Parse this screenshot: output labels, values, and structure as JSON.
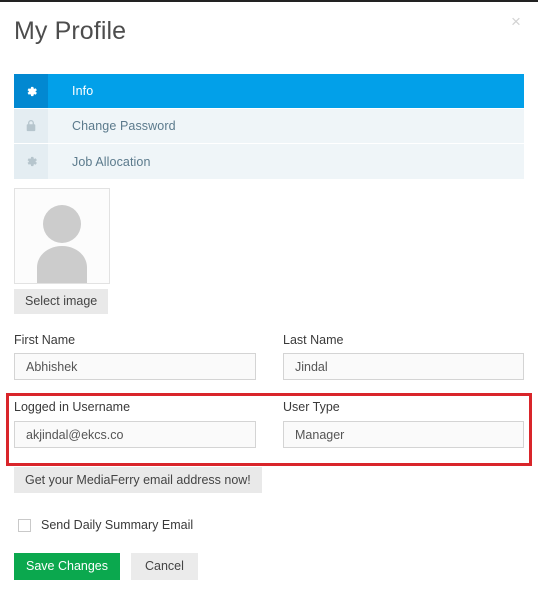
{
  "window": {
    "title": "My Profile",
    "close_label": "×"
  },
  "tabs": [
    {
      "label": "Info",
      "icon": "gear-icon",
      "active": true
    },
    {
      "label": "Change Password",
      "icon": "lock-icon",
      "active": false
    },
    {
      "label": "Job Allocation",
      "icon": "gear-icon",
      "active": false
    }
  ],
  "avatar": {
    "icon": "user-placeholder-icon",
    "select_image_label": "Select image"
  },
  "form": {
    "first_name": {
      "label": "First Name",
      "value": "Abhishek",
      "placeholder": "First Name"
    },
    "last_name": {
      "label": "Last Name",
      "value": "Jindal",
      "placeholder": "Last Name"
    },
    "logged_in_username": {
      "label": "Logged in Username",
      "value": "akjindal@ekcs.co",
      "placeholder": "Logged in Username"
    },
    "user_type": {
      "label": "User Type",
      "value": "Manager",
      "placeholder": "User Type"
    }
  },
  "mediaferry_button": {
    "label": "Get your MediaFerry email address now!"
  },
  "daily_summary": {
    "label": "Send Daily Summary Email",
    "checked": false
  },
  "footer": {
    "save_label": "Save Changes",
    "cancel_label": "Cancel"
  },
  "colors": {
    "accent_blue": "#02a0e9",
    "accent_blue_dark": "#0288d1",
    "tab_inactive": "#eff5f8",
    "save_green": "#0ba84e",
    "highlight_red": "#d9252a",
    "button_gray": "#e9e9e9"
  }
}
